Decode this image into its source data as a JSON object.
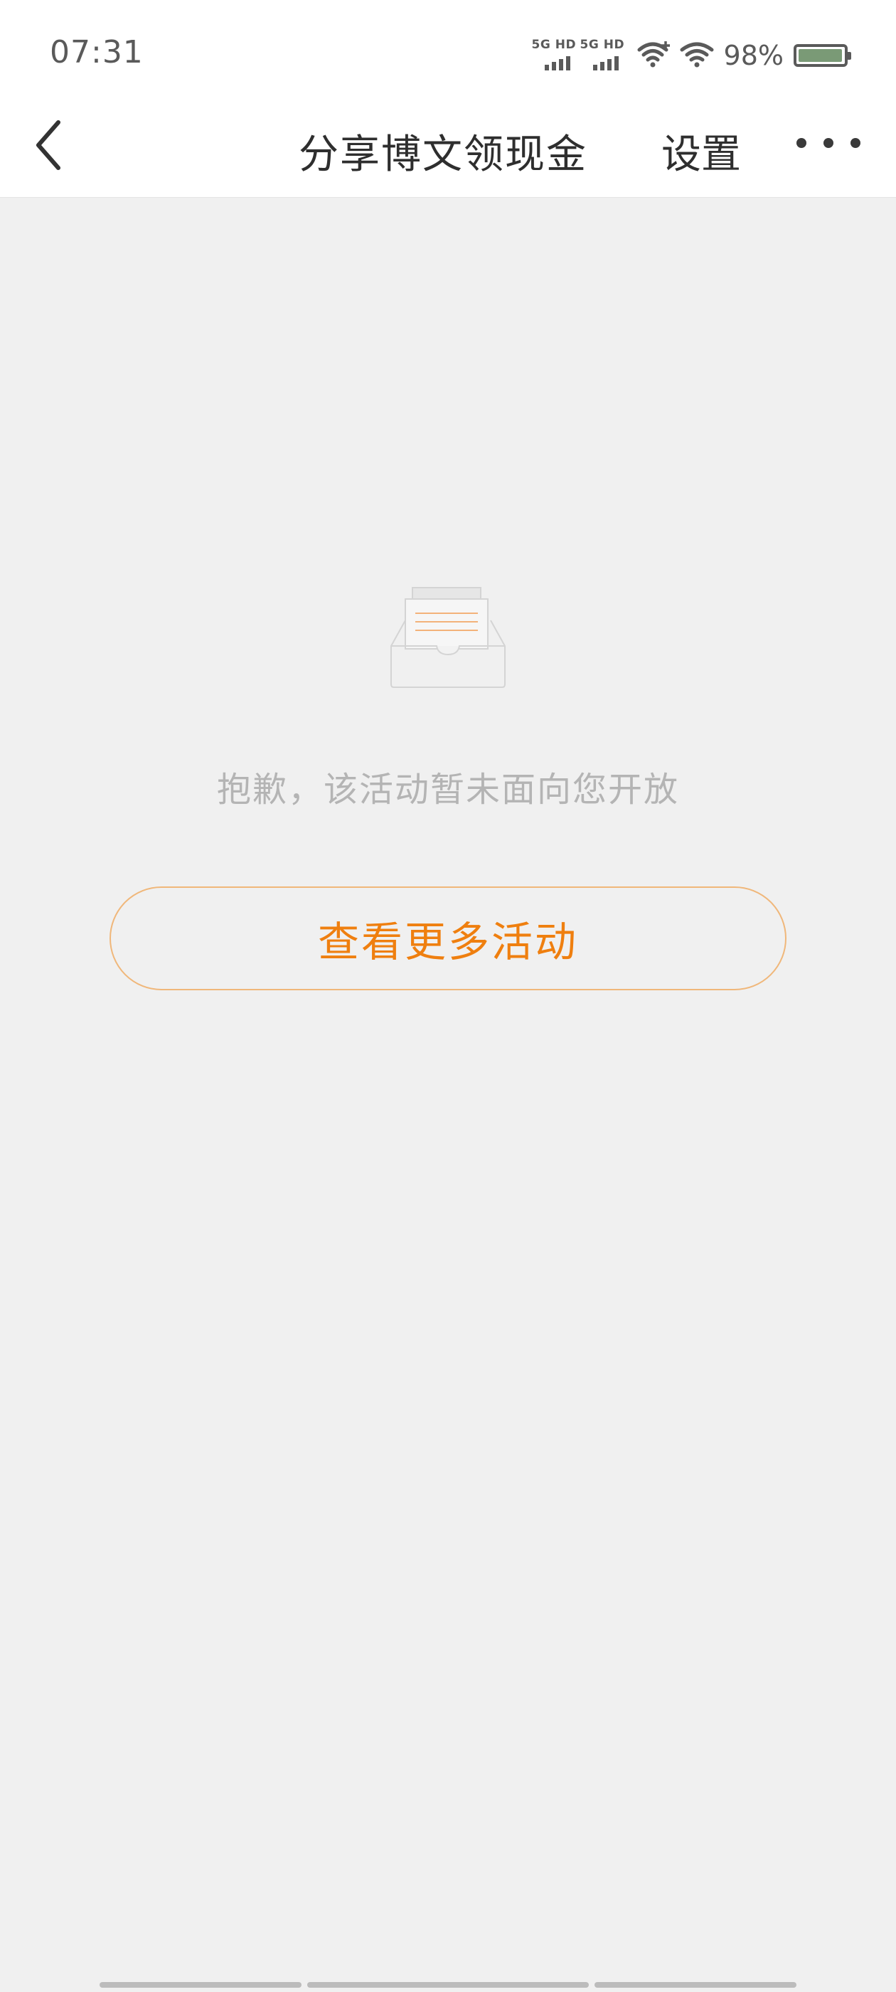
{
  "status_bar": {
    "time": "07:31",
    "sim1_label": "5G HD",
    "sim2_label": "5G HD",
    "battery_percent": "98%",
    "battery_level": 0.98,
    "icons": [
      "signal-icon",
      "signal-icon",
      "wifi-plus-icon",
      "wifi-icon",
      "battery-icon"
    ]
  },
  "nav": {
    "back_icon": "chevron-left-icon",
    "title": "分享博文领现金",
    "settings_label": "设置",
    "more_icon": "more-dots-icon"
  },
  "empty_state": {
    "illustration": "empty-inbox-icon",
    "message": "抱歉，该活动暂未面向您开放",
    "button_label": "查看更多活动"
  },
  "colors": {
    "accent": "#ef7f0f",
    "button_border": "#f0b77a",
    "background": "#f0f0f0",
    "message_text": "#b4b4b4",
    "battery_fill": "#7a9a76"
  }
}
